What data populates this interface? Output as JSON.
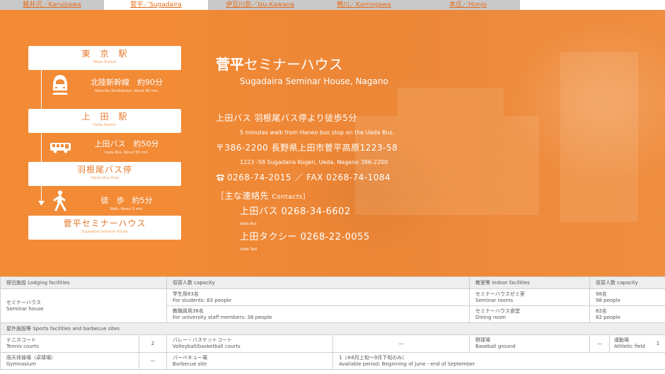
{
  "tabs": [
    {
      "label": "軽井沢／Karuizawa",
      "active": false
    },
    {
      "label": "菅平／Sugadaira",
      "active": true
    },
    {
      "label": "伊豆川奈／Izu-Kawana",
      "active": false
    },
    {
      "label": "鴨川／Kamogawa",
      "active": false
    },
    {
      "label": "本庄／Honjo",
      "active": false
    }
  ],
  "route": {
    "stations": [
      {
        "jp": "東　京　駅",
        "en": "Tokyo Station"
      },
      {
        "jp": "上　田　駅",
        "en": "Ueda Station"
      },
      {
        "jp": "羽根尾バス停",
        "en": "Honeo Bus Stop"
      },
      {
        "jp": "菅平セミナーハウス",
        "en": "Sugadaira Seminar House"
      }
    ],
    "segments": [
      {
        "icon": "bullet-train-icon",
        "jp": "北陸新幹線　約90分",
        "en": "Hokuriku Shinkansen: About 90 min."
      },
      {
        "icon": "bus-icon",
        "jp": "上田バス　約50分",
        "en": "Ueda Bus: About 50 min."
      },
      {
        "icon": "walking-person-icon",
        "jp": "徒　歩　約5分",
        "en": "Walk: About 5 min."
      }
    ]
  },
  "info": {
    "title_bold": "菅平",
    "title_rest": "セミナーハウス",
    "subtitle": "Sugadaira Seminar House, Nagano",
    "access_jp": "上田バス 羽根尾バス停より徒歩5分",
    "access_en": "5 minutes walk from Haneo bus stop on the Ueda Bus.",
    "address_jp": "〒386-2200 長野県上田市菅平高原1223-58",
    "address_en": "1223 -58 Sugadaira Kogen, Ueda, Nagano 386-2200",
    "phone_icon": "phone-icon",
    "phone_fax": "0268-74-2015 ／ FAX 0268-74-1084",
    "contacts_heading_jp": "［主な連絡先",
    "contacts_heading_en": "Contacts］",
    "contacts": [
      {
        "jp": "上田バス 0268-34-6602",
        "en": "Ueda Bus"
      },
      {
        "jp": "上田タクシー 0268-22-0055",
        "en": "Ueda Taxi"
      }
    ]
  },
  "facilities": {
    "headers": {
      "lodging": "宿泊施設 Lodging facilities",
      "capacity": "収容人数 capacity",
      "indoor": "教室等 Indoor facilities",
      "capacity2": "収容人数 capacity"
    },
    "lodging_name_jp": "セミナーハウス",
    "lodging_name_en": "Seminar house",
    "students_jp": "学生用83名",
    "students_en": "For students: 83 people",
    "staff_jp": "教職員用38名",
    "staff_en": "For university staff members: 38 people",
    "room1_jp": "セミナーハウスゼミ室",
    "room1_en": "Seminar rooms",
    "room1_cap_jp": "98名",
    "room1_cap_en": "98 people",
    "room2_jp": "セミナーハウス食堂",
    "room2_en": "Dining room",
    "room2_cap_jp": "82名",
    "room2_cap_en": "82 people",
    "outdoor_header": "屋外施設等 Sports facilities and barbecue sites",
    "tennis_jp": "テニスコート",
    "tennis_en": "Tennis courts",
    "tennis_count": "2",
    "volley_jp": "バレー・バスケットコート",
    "volley_en": "Volleyball/basketball courts",
    "volley_count": "—",
    "baseball_jp": "野球場",
    "baseball_en": "Baseball ground",
    "baseball_count": "—",
    "athletic_jp": "運動場",
    "athletic_en": "Athletic field",
    "athletic_count": "1",
    "gym_jp": "雨天体操場（卓球場）",
    "gym_en": "Gymnasium",
    "gym_count": "—",
    "bbq_jp": "バーベキュー場",
    "bbq_en": "Barbecue site",
    "bbq_note_jp": "1（※6月上旬～9月下旬のみ）",
    "bbq_note_en": "Available period: Beginning of June - end of September"
  },
  "colors": {
    "accent": "#f28a36",
    "route_text": "#e8772a",
    "tab_link": "#e86b17"
  }
}
